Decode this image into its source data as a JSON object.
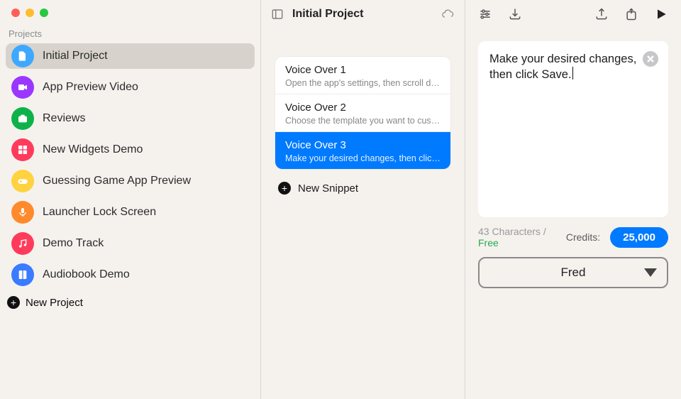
{
  "sidebar": {
    "section_label": "Projects",
    "items": [
      {
        "label": "Initial Project",
        "color": "#3ea8ff",
        "icon": "document",
        "selected": true
      },
      {
        "label": "App Preview Video",
        "color": "#9b36ff",
        "icon": "video",
        "selected": false
      },
      {
        "label": "Reviews",
        "color": "#0eb24a",
        "icon": "camera",
        "selected": false
      },
      {
        "label": "New Widgets Demo",
        "color": "#ff3b5c",
        "icon": "widgets",
        "selected": false
      },
      {
        "label": "Guessing Game App Preview",
        "color": "#ffd23f",
        "icon": "gamepad",
        "selected": false
      },
      {
        "label": "Launcher Lock Screen",
        "color": "#ff8a2b",
        "icon": "mic",
        "selected": false
      },
      {
        "label": "Demo Track",
        "color": "#ff3b5c",
        "icon": "music",
        "selected": false
      },
      {
        "label": "Audiobook Demo",
        "color": "#3a7bff",
        "icon": "book",
        "selected": false
      }
    ],
    "new_project_label": "New Project"
  },
  "center": {
    "title": "Initial Project",
    "snippets": [
      {
        "title": "Voice Over 1",
        "sub": "Open the app's settings, then scroll down until you find the advanced options.",
        "selected": false
      },
      {
        "title": "Voice Over 2",
        "sub": "Choose the template you want to customize and tap the edit button to continue.",
        "selected": false
      },
      {
        "title": "Voice Over 3",
        "sub": "Make your desired changes, then click Save.",
        "selected": true
      }
    ],
    "new_snippet_label": "New Snippet"
  },
  "editor": {
    "text": "Make your desired changes, then click Save.",
    "char_count": "43",
    "char_suffix": " Characters / ",
    "tier": "Free",
    "credits_label": "Credits:",
    "credits_value": "25,000",
    "voice": "Fred"
  }
}
